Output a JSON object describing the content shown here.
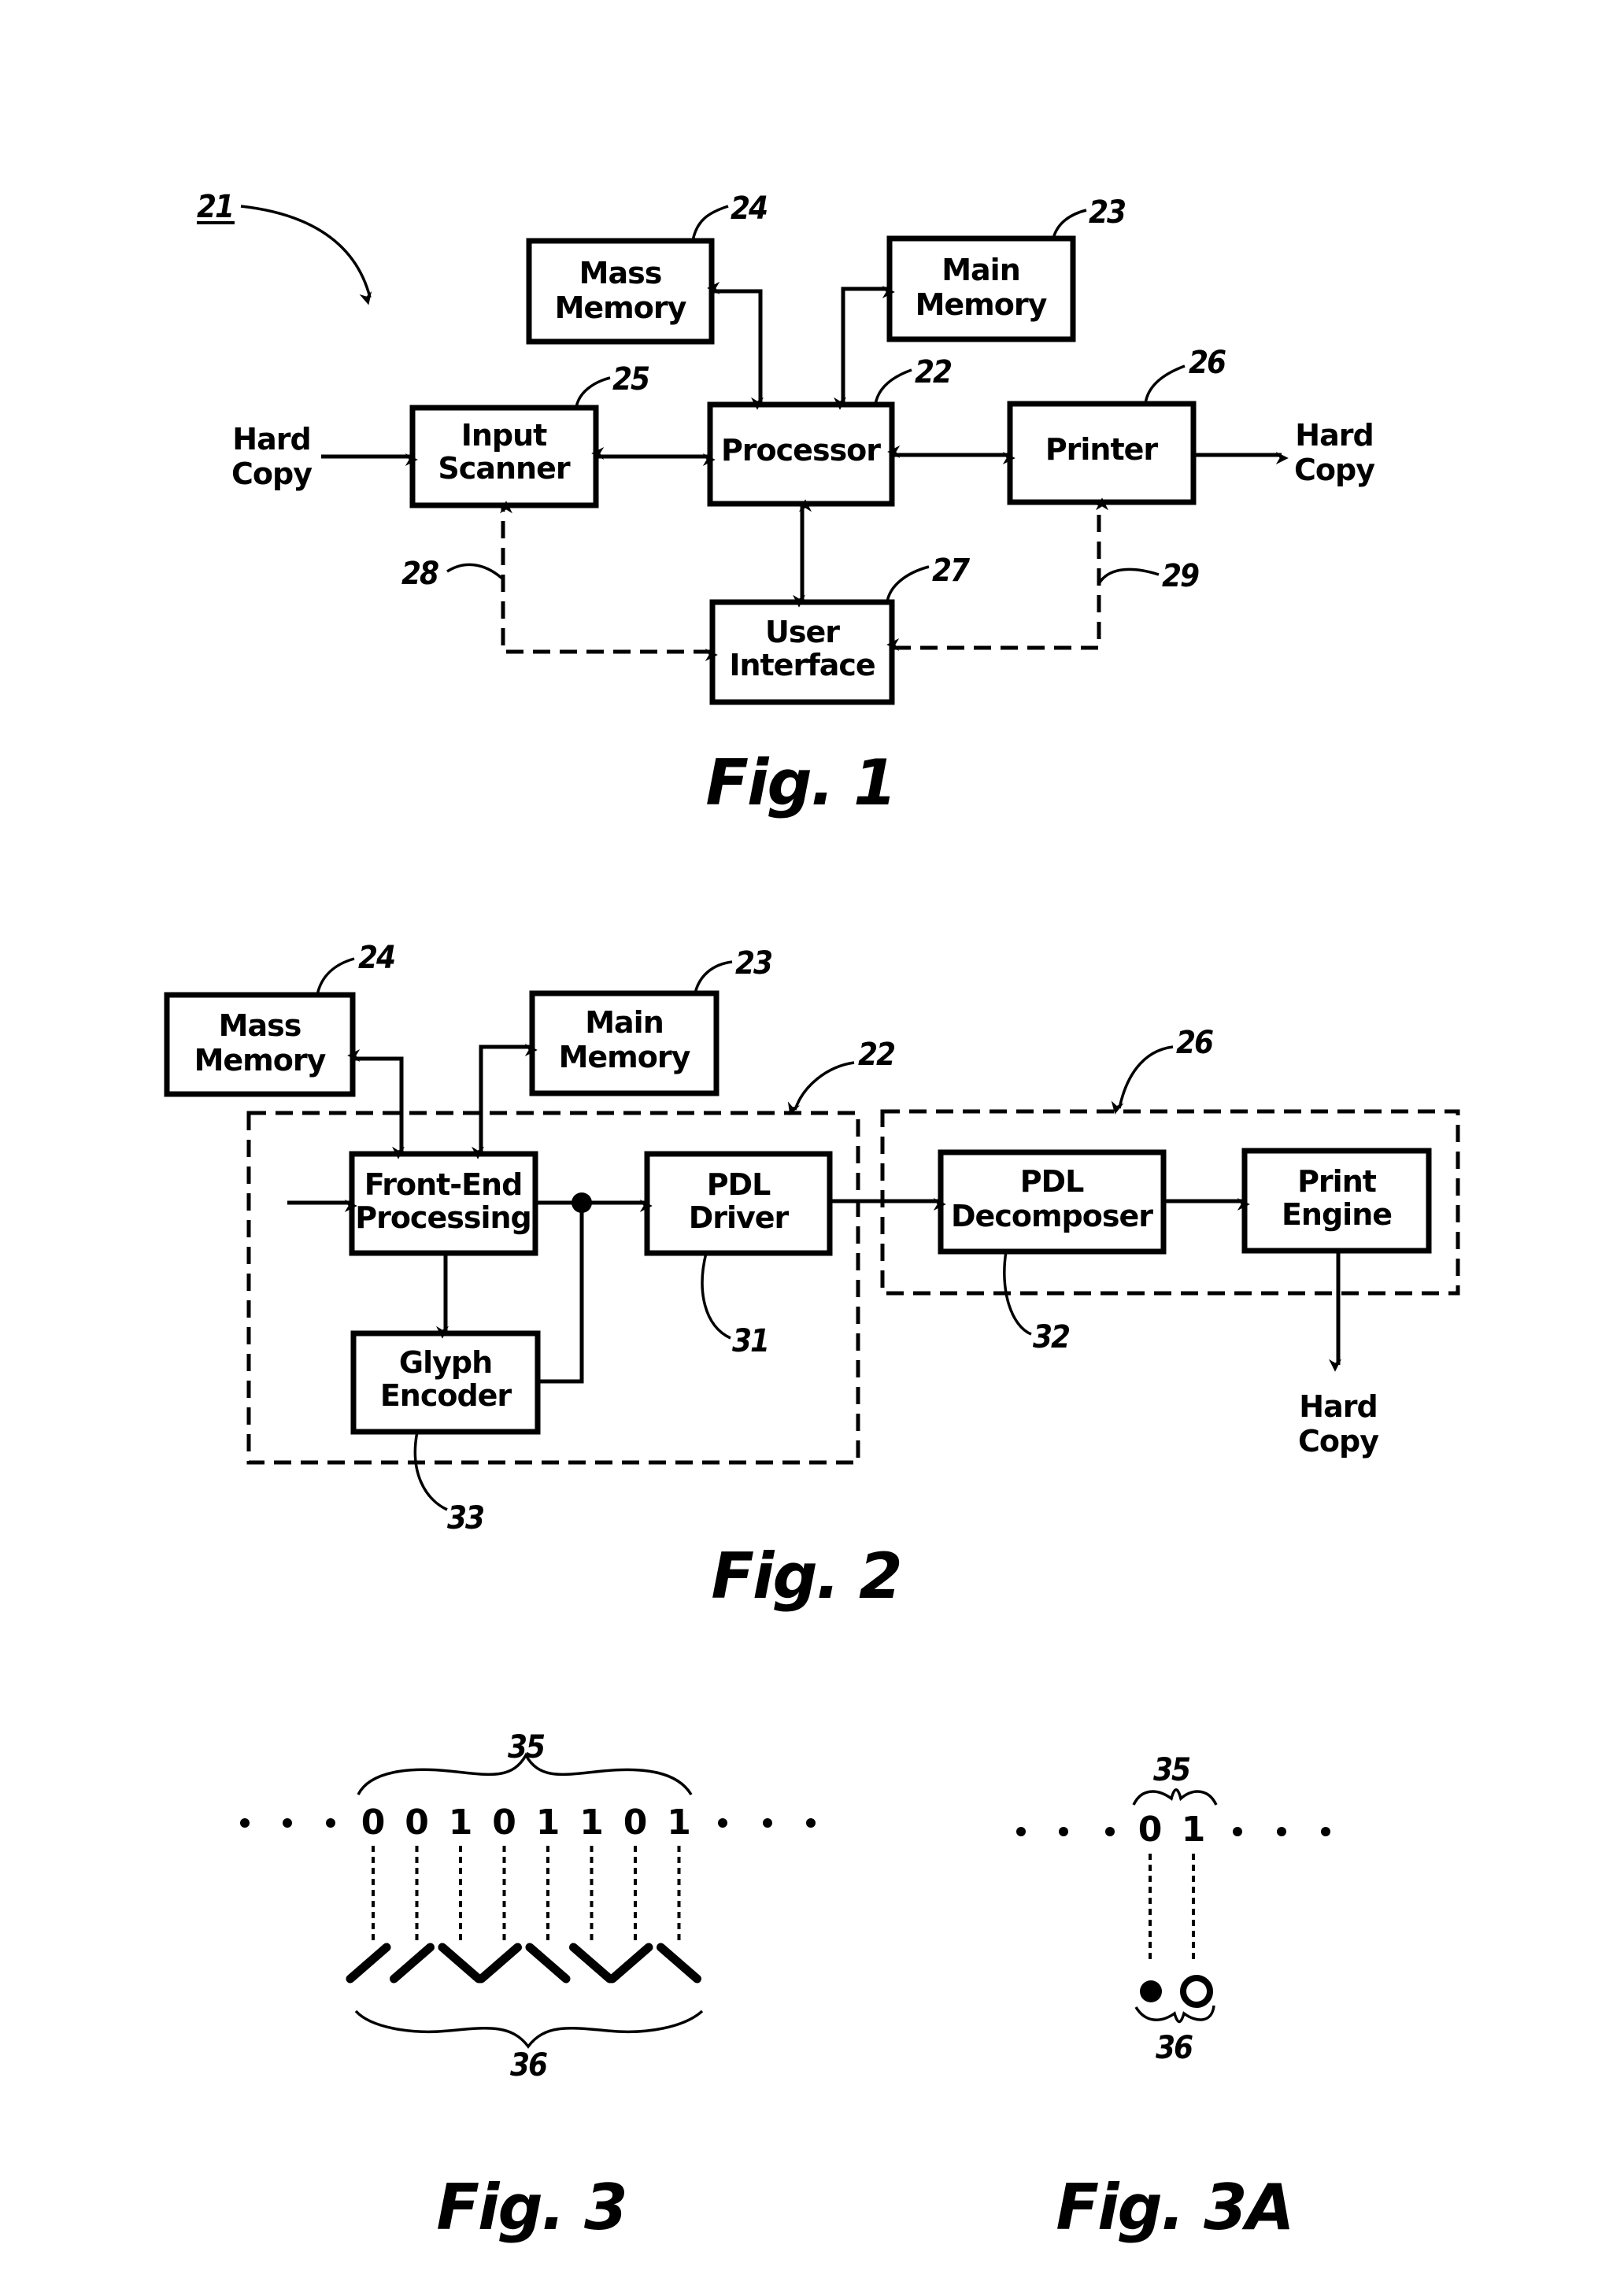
{
  "figures": {
    "fig1": {
      "caption": "Fig. 1",
      "system_ref": "21",
      "blocks": {
        "mass_memory": {
          "line1": "Mass",
          "line2": "Memory",
          "ref": "24"
        },
        "main_memory": {
          "line1": "Main",
          "line2": "Memory",
          "ref": "23"
        },
        "input_scanner": {
          "line1": "Input",
          "line2": "Scanner",
          "ref": "25"
        },
        "processor": {
          "line1": "Processor",
          "ref": "22"
        },
        "printer": {
          "line1": "Printer",
          "ref": "26"
        },
        "user_interface": {
          "line1": "User",
          "line2": "Interface",
          "ref": "27"
        }
      },
      "input_label": {
        "line1": "Hard",
        "line2": "Copy"
      },
      "output_label": {
        "line1": "Hard",
        "line2": "Copy"
      },
      "control_paths": {
        "scanner_ref": "28",
        "printer_ref": "29"
      }
    },
    "fig2": {
      "caption": "Fig. 2",
      "blocks": {
        "mass_memory": {
          "line1": "Mass",
          "line2": "Memory",
          "ref": "24"
        },
        "main_memory": {
          "line1": "Main",
          "line2": "Memory",
          "ref": "23"
        },
        "front_end": {
          "line1": "Front-End",
          "line2": "Processing"
        },
        "glyph_encoder": {
          "line1": "Glyph",
          "line2": "Encoder",
          "ref": "33"
        },
        "pdl_driver": {
          "line1": "PDL",
          "line2": "Driver",
          "ref": "31"
        },
        "pdl_decomposer": {
          "line1": "PDL",
          "line2": "Decomposer",
          "ref": "32"
        },
        "print_engine": {
          "line1": "Print",
          "line2": "Engine"
        }
      },
      "groups": {
        "processor_ref": "22",
        "printer_ref": "26"
      },
      "output_label": {
        "line1": "Hard",
        "line2": "Copy"
      }
    },
    "fig3": {
      "caption": "Fig. 3",
      "bits": [
        "0",
        "0",
        "1",
        "0",
        "1",
        "1",
        "0",
        "1"
      ],
      "glyph_encoding": {
        "0": "slash-forward",
        "1": "slash-back"
      },
      "bits_ref": "35",
      "glyphs_ref": "36",
      "ellipsis": "• • •"
    },
    "fig3a": {
      "caption": "Fig. 3A",
      "bits": [
        "0",
        "1"
      ],
      "glyph_encoding": {
        "0": "filled-circle",
        "1": "hollow-circle"
      },
      "bits_ref": "35",
      "glyphs_ref": "36"
    }
  }
}
